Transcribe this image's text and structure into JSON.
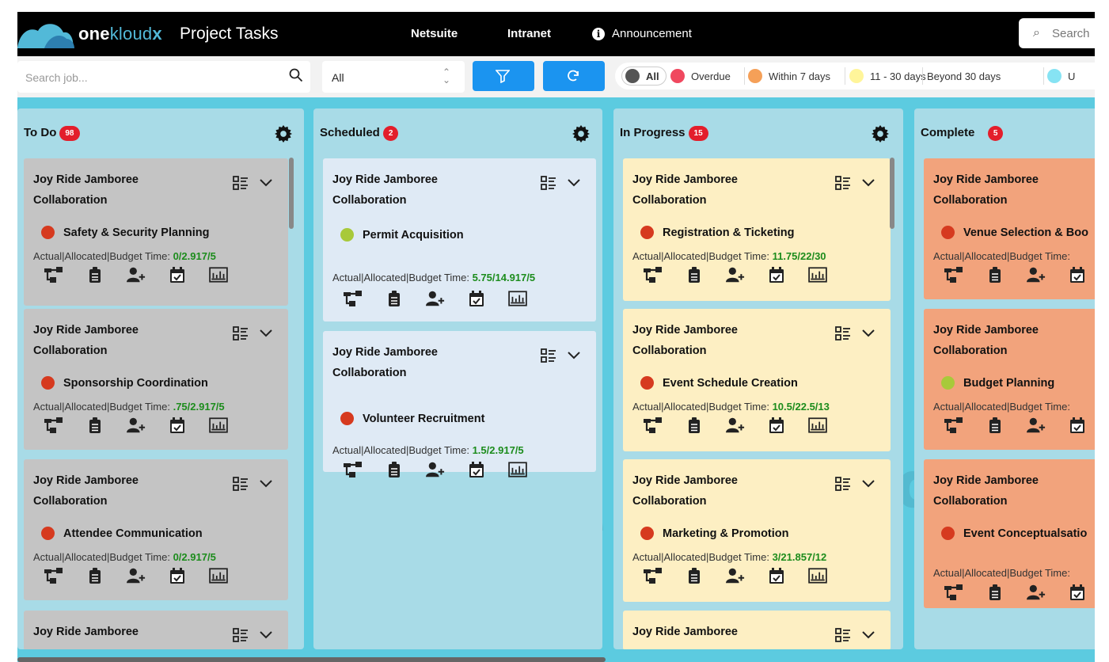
{
  "header": {
    "logo_one": "one",
    "logo_kloud": "kloud",
    "logo_x": "x",
    "app_title": "Project Tasks",
    "nav": [
      "Netsuite",
      "Intranet",
      "Announcement"
    ],
    "search_placeholder": "Search",
    "colors": {
      "bg": "#000000",
      "logo_accent": "#52b9d8"
    }
  },
  "filters": {
    "job_search_placeholder": "Search job...",
    "select_value": "All",
    "filter_button_icon": "filter-icon",
    "refresh_button_icon": "refresh-icon",
    "legend": [
      {
        "label": "All",
        "color": "#555555"
      },
      {
        "label": "Overdue",
        "color": "#f0485f"
      },
      {
        "label": "Within 7 days",
        "color": "#f5a058"
      },
      {
        "label": "11 - 30 days",
        "color": "#fff59a"
      },
      {
        "label": "Beyond 30 days",
        "color": "#ffffff"
      },
      {
        "label": "U",
        "color": "#86e3f3"
      }
    ]
  },
  "time_label": "Actual|Allocated|Budget Time: ",
  "columns": [
    {
      "title": "To Do",
      "count": "98",
      "cards": [
        {
          "job": "Joy Ride Jamboree Collaboration",
          "task": "Safety & Security Planning",
          "dot": "#d63a1f",
          "time": "0/2.917/5"
        },
        {
          "job": "Joy Ride Jamboree Collaboration",
          "task": "Sponsorship Coordination",
          "dot": "#d63a1f",
          "time": ".75/2.917/5"
        },
        {
          "job": "Joy Ride Jamboree Collaboration",
          "task": "Attendee Communication",
          "dot": "#d63a1f",
          "time": "0/2.917/5"
        },
        {
          "job": "Joy Ride Jamboree"
        }
      ]
    },
    {
      "title": "Scheduled",
      "count": "2",
      "cards": [
        {
          "job": "Joy Ride Jamboree Collaboration",
          "task": "Permit Acquisition",
          "dot": "#a8c93a",
          "time": "5.75/14.917/5"
        },
        {
          "job": "Joy Ride Jamboree Collaboration",
          "task": "Volunteer Recruitment",
          "dot": "#d63a1f",
          "time": "1.5/2.917/5"
        }
      ]
    },
    {
      "title": "In Progress",
      "count": "15",
      "cards": [
        {
          "job": "Joy Ride Jamboree Collaboration",
          "task": "Registration & Ticketing",
          "dot": "#d63a1f",
          "time": "11.75/22/30"
        },
        {
          "job": "Joy Ride Jamboree Collaboration",
          "task": "Event Schedule Creation",
          "dot": "#d63a1f",
          "time": "10.5/22.5/13"
        },
        {
          "job": "Joy Ride Jamboree Collaboration",
          "task": "Marketing & Promotion",
          "dot": "#d63a1f",
          "time": "3/21.857/12"
        },
        {
          "job": "Joy Ride Jamboree"
        }
      ]
    },
    {
      "title": "Complete",
      "count": "5",
      "cards": [
        {
          "job": "Joy Ride Jamboree Collaboration",
          "task": "Venue Selection & Boo",
          "dot": "#d63a1f",
          "time_label": "Actual|Allocated|Budget Time:"
        },
        {
          "job": "Joy Ride Jamboree Collaboration",
          "task": "Budget Planning",
          "dot": "#a8c93a",
          "time_label": "Actual|Allocated|Budget Time:"
        },
        {
          "job": "Joy Ride Jamboree Collaboration",
          "task": "Event Conceptualsatio",
          "dot": "#d63a1f",
          "time_label": "Actual|Allocated|Budget Time:"
        }
      ]
    }
  ],
  "card_actions": [
    "hierarchy-icon",
    "clipboard-icon",
    "add-user-icon",
    "calendar-check-icon",
    "chart-icon"
  ],
  "card_colors": {
    "todo": "#c4c4c4",
    "scheduled": "#dfeaf5",
    "in_progress": "#fdefc3",
    "complete": "#f2a37c"
  }
}
